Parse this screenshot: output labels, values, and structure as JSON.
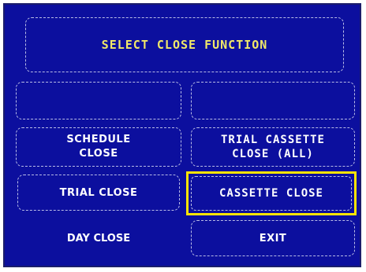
{
  "screen": {
    "title": "SELECT CLOSE FUNCTION",
    "colors": {
      "background": "#0c0f9e",
      "title_text": "#f0e868",
      "button_text": "#ffffff",
      "selection_highlight": "#ffe400"
    }
  },
  "left_buttons": {
    "schedule_close_line1": "SCHEDULE",
    "schedule_close_line2": "CLOSE",
    "trial_close": "TRIAL CLOSE",
    "day_close": "DAY CLOSE"
  },
  "right_buttons": {
    "trial_cassette_line1": "TRIAL CASSETTE",
    "trial_cassette_line2": "CLOSE (ALL)",
    "cassette_close": "CASSETTE CLOSE",
    "exit": "EXIT"
  }
}
